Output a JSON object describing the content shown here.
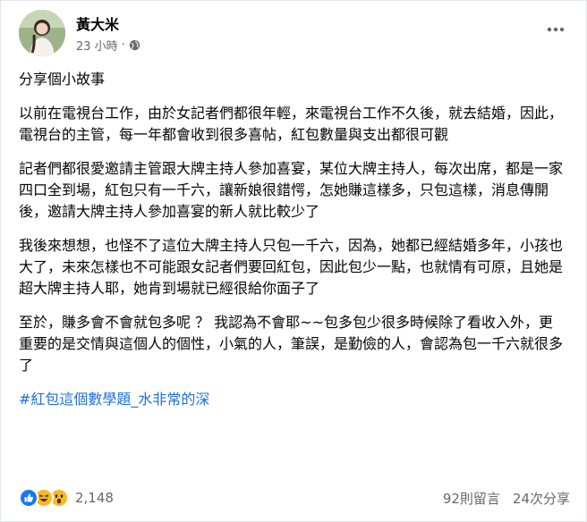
{
  "post": {
    "author": "黃大米",
    "time": "23 小時",
    "dot": "·",
    "privacy_icon": "globe-icon",
    "more_icon": "more-horizontal-icon",
    "title": "分享個小故事",
    "paragraphs": [
      "以前在電視台工作，由於女記者們都很年輕，來電視台工作不久後，就去結婚，因此，電視台的主管，每一年都會收到很多喜帖，紅包數量與支出都很可觀",
      "記者們都很愛邀請主管跟大牌主持人參加喜宴，某位大牌主持人，每次出席，都是一家四口全到場，紅包只有一千六，讓新娘很錯愕，怎她賺這樣多，只包這樣，消息傳開後，邀請大牌主持人參加喜宴的新人就比較少了",
      "我後來想想，也怪不了這位大牌主持人只包一千六，因為，她都已經結婚多年，小孩也大了，未來怎樣也不可能跟女記者們要回紅包，因此包少一點，也就情有可原，且她是超大牌主持人耶，她肯到場就已經很給你面子了",
      "至於，賺多會不會就包多呢 ？ 我認為不會耶~~包多包少很多時候除了看收入外，更重要的是交情與這個人的個性，小氣的人，筆誤，是勤儉的人，會認為包一千六就很多了"
    ],
    "hashtag": "#紅包這個數學題_水非常的深"
  },
  "footer": {
    "reaction_icons": [
      "like-icon",
      "haha-icon",
      "wow-icon"
    ],
    "reaction_count": "2,148",
    "comments": "92則留言",
    "shares": "24次分享"
  },
  "colors": {
    "link": "#216fdb",
    "secondary_text": "#65676b",
    "like_blue": "#1877f2",
    "emoji_yellow": "#f7b928"
  }
}
